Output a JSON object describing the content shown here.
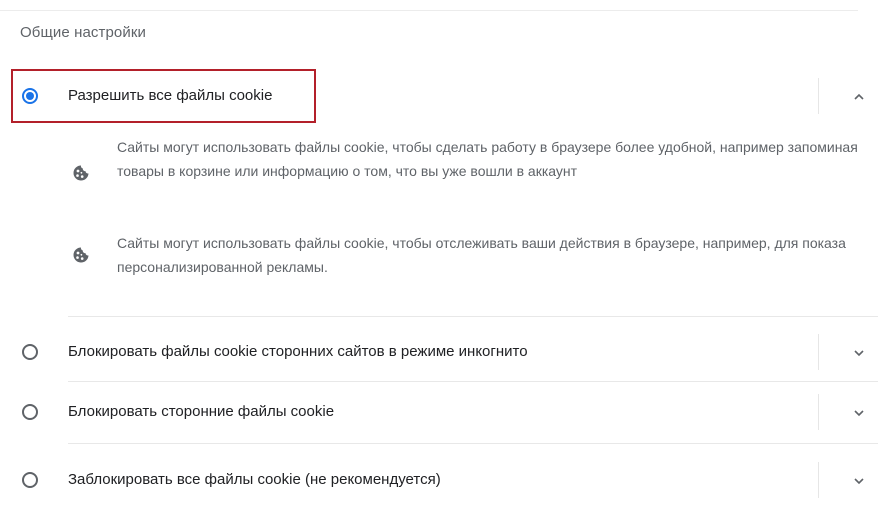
{
  "section": {
    "title": "Общие настройки"
  },
  "options": [
    {
      "label": "Разрешить все файлы cookie",
      "checked": true,
      "expanded": true,
      "chevron": "chevron-up-icon",
      "details": [
        {
          "icon": "cookie-icon",
          "text": "Сайты могут использовать файлы cookie, чтобы сделать работу в браузере более удобной, например запоминая товары в корзине или информацию о том, что вы уже вошли в аккаунт"
        },
        {
          "icon": "cookie-icon",
          "text": "Сайты могут использовать файлы cookie, чтобы отслеживать ваши действия в браузере, например, для показа персонализированной рекламы."
        }
      ]
    },
    {
      "label": "Блокировать файлы cookie сторонних сайтов в режиме инкогнито",
      "checked": false,
      "expanded": false,
      "chevron": "chevron-down-icon"
    },
    {
      "label": "Блокировать сторонние файлы cookie",
      "checked": false,
      "expanded": false,
      "chevron": "chevron-down-icon"
    },
    {
      "label": "Заблокировать все файлы cookie (не рекомендуется)",
      "checked": false,
      "expanded": false,
      "chevron": "chevron-down-icon"
    }
  ],
  "colors": {
    "accent": "#1a73e8",
    "highlight_border": "#b3202a",
    "secondary_text": "#5f6368",
    "primary_text": "#202124"
  }
}
